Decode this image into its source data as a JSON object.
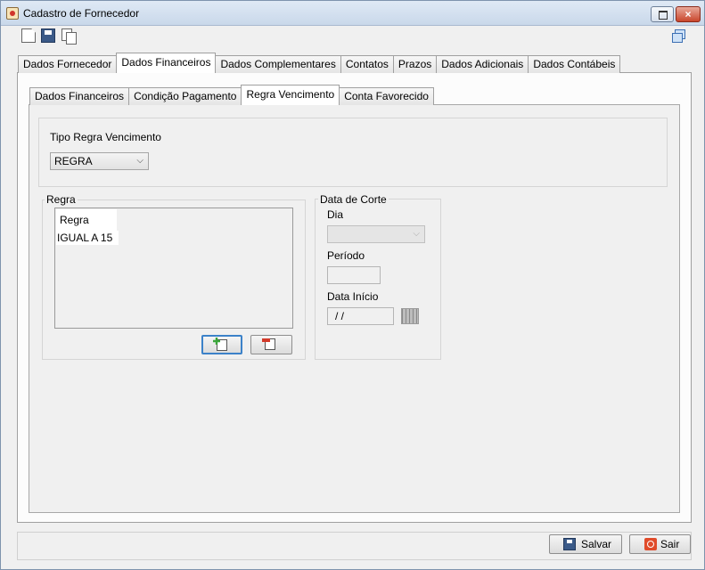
{
  "window": {
    "title": "Cadastro de Fornecedor",
    "close_glyph": "×"
  },
  "toolbar": {
    "icons": [
      "new-document-icon",
      "save-icon",
      "copy-icon",
      "windows-icon"
    ]
  },
  "main_tabs": [
    {
      "label": "Dados Fornecedor",
      "active": false
    },
    {
      "label": "Dados Financeiros",
      "active": true
    },
    {
      "label": "Dados Complementares",
      "active": false
    },
    {
      "label": "Contatos",
      "active": false
    },
    {
      "label": "Prazos",
      "active": false
    },
    {
      "label": "Dados Adicionais",
      "active": false
    },
    {
      "label": "Dados Contábeis",
      "active": false
    }
  ],
  "sub_tabs": [
    {
      "label": "Dados Financeiros",
      "active": false
    },
    {
      "label": "Condição Pagamento",
      "active": false
    },
    {
      "label": "Regra Vencimento",
      "active": true
    },
    {
      "label": "Conta Favorecido",
      "active": false
    }
  ],
  "tipo_regra": {
    "label": "Tipo Regra Vencimento",
    "value": "REGRA",
    "arrow": "⌵"
  },
  "regra": {
    "legend": "Regra",
    "column_header": "Regra",
    "rows": [
      "IGUAL A 15"
    ]
  },
  "data_corte": {
    "legend": "Data de Corte",
    "dia_label": "Dia",
    "dia_value": "",
    "dia_arrow": "⌵",
    "periodo_label": "Período",
    "periodo_value": "",
    "data_inicio_label": "Data Início",
    "data_inicio_value": " / /"
  },
  "footer": {
    "save_label": "Salvar",
    "exit_label": "Sair"
  },
  "colors": {
    "window_border": "#7e93ad",
    "close_button": "#c9462c",
    "focus_blue": "#3c82c9"
  }
}
